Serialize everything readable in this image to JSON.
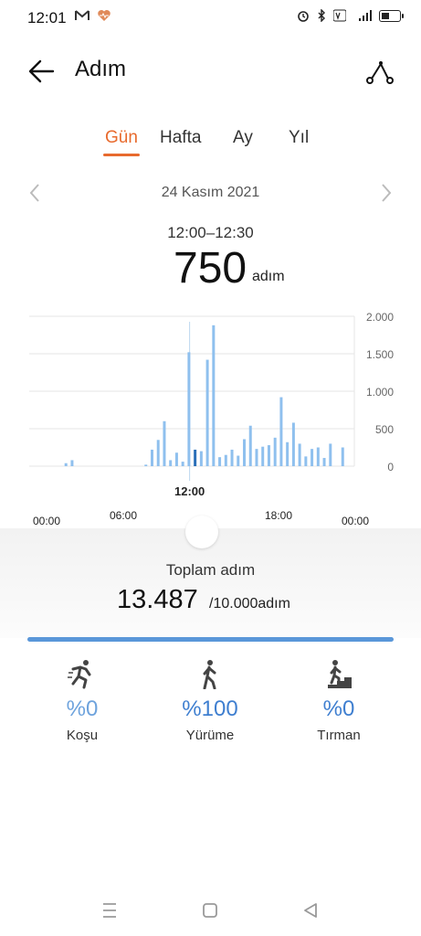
{
  "status": {
    "time": "12:01",
    "left_icons": [
      "gmail-icon",
      "health-heart-icon"
    ],
    "right_icons": [
      "alarm-icon",
      "bluetooth-icon",
      "volte-icon",
      "signal-4g-icon",
      "battery-icon"
    ]
  },
  "header": {
    "title": "Adım",
    "back_icon": "arrow-left-icon",
    "route_icon": "route-icon"
  },
  "tabs": [
    {
      "label": "Gün",
      "active": true
    },
    {
      "label": "Hafta",
      "active": false
    },
    {
      "label": "Ay",
      "active": false
    },
    {
      "label": "Yıl",
      "active": false
    }
  ],
  "date": {
    "label": "24 Kasım 2021",
    "prev_icon": "chevron-left-icon",
    "next_icon": "chevron-right-icon"
  },
  "selected": {
    "range": "12:00–12:30",
    "value": "750",
    "unit": "adım"
  },
  "chart_data": {
    "type": "bar",
    "y_ticks": [
      "2.000",
      "1.500",
      "1.000",
      "500",
      "0"
    ],
    "ylim": [
      0,
      2000
    ],
    "x_ticks": [
      "00:00",
      "06:00",
      "12:00",
      "18:00",
      "00:00"
    ],
    "selected_label": "12:00",
    "bar_color": "#8fc0ee",
    "selected_color": "#2a6fb8",
    "selected_index": 24,
    "values": [
      0,
      0,
      0,
      40,
      80,
      0,
      0,
      0,
      0,
      0,
      0,
      0,
      0,
      0,
      0,
      0,
      20,
      220,
      350,
      600,
      80,
      180,
      60,
      1520,
      220,
      200,
      1420,
      1880,
      120,
      150,
      220,
      140,
      360,
      540,
      230,
      260,
      280,
      380,
      920,
      320,
      580,
      300,
      130,
      230,
      250,
      110,
      300,
      0,
      250,
      0
    ],
    "grid": true
  },
  "summary": {
    "label": "Toplam adım",
    "value": "13.487",
    "goal": "/10.000adım",
    "progress": 1.0
  },
  "activities": [
    {
      "icon": "running-icon",
      "percent": "%0",
      "label": "Koşu"
    },
    {
      "icon": "walking-icon",
      "percent": "%100",
      "label": "Yürüme"
    },
    {
      "icon": "climbing-icon",
      "percent": "%0",
      "label": "Tırman"
    }
  ],
  "nav": [
    "menu-icon",
    "home-square-icon",
    "back-triangle-icon"
  ]
}
